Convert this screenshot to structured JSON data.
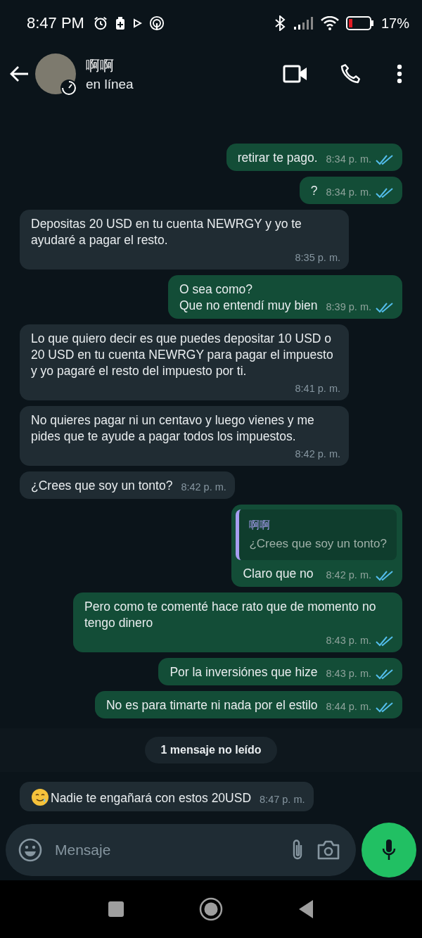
{
  "status_bar": {
    "time": "8:47 PM",
    "battery": "17%"
  },
  "header": {
    "contact_name": "啊啊",
    "status": "en línea"
  },
  "messages": [
    {
      "kind": "out",
      "text": "retirar te pago.",
      "time": "8:34 p. m.",
      "read": true
    },
    {
      "kind": "out",
      "text": "?",
      "time": "8:34 p. m.",
      "read": true
    },
    {
      "kind": "in",
      "text": "Depositas 20 USD en tu cuenta NEWRGY y yo te ayudaré a pagar el resto.",
      "time": "8:35 p. m."
    },
    {
      "kind": "out",
      "text": "O sea como?\nQue no entendí muy bien",
      "time": "8:39 p. m.",
      "read": true
    },
    {
      "kind": "in",
      "text": "Lo que quiero decir es que puedes depositar 10 USD o 20 USD en tu cuenta NEWRGY para pagar el impuesto y yo pagaré el resto del impuesto por ti.",
      "time": "8:41 p. m."
    },
    {
      "kind": "in",
      "text": "No quieres pagar ni un centavo y luego vienes y me pides que te ayude a pagar todos los impuestos.",
      "time": "8:42 p. m."
    },
    {
      "kind": "in",
      "text": "¿Crees que soy un tonto?",
      "time": "8:42 p. m."
    },
    {
      "kind": "out",
      "text": "Claro que no",
      "time": "8:42 p. m.",
      "read": true,
      "quote": {
        "author": "啊啊",
        "text": "¿Crees que soy un tonto?"
      }
    },
    {
      "kind": "out",
      "text": "Pero como te comenté hace rato que de momento no tengo dinero",
      "time": "8:43 p. m.",
      "read": true
    },
    {
      "kind": "out",
      "text": "Por la inversiónes que hize",
      "time": "8:43 p. m.",
      "read": true
    },
    {
      "kind": "out",
      "text": "No es para timarte ni nada por el estilo",
      "time": "8:44 p. m.",
      "read": true
    },
    {
      "kind": "divider",
      "text": "1 mensaje no leído"
    },
    {
      "kind": "in",
      "text": "Nadie te engañará con estos 20USD",
      "time": "8:47 p. m.",
      "emoji": true
    }
  ],
  "composer": {
    "placeholder": "Mensaje"
  }
}
